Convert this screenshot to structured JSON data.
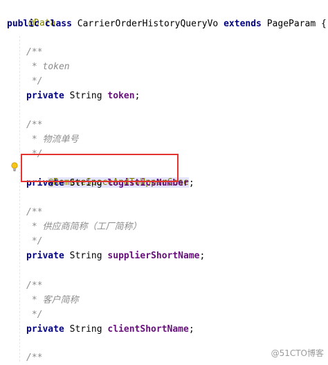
{
  "code": {
    "annotation_data": "@Data",
    "class_decl": {
      "kw_public": "public",
      "kw_class": "class",
      "class_name": "CarrierOrderHistoryQueryVo",
      "kw_extends": "extends",
      "super_name": "PageParam",
      "brace": "{"
    },
    "blocks": [
      {
        "doc_open": "/**",
        "doc_text": " * token",
        "doc_close": " */",
        "kw_private": "private",
        "type": "String",
        "field": "token",
        "semi": ";"
      },
      {
        "doc_open": "/**",
        "doc_text": " * 物流单号",
        "doc_close": " */",
        "annotation": "@RemoveSpaceAndToUpperCase",
        "kw_private": "private",
        "type": "String",
        "field": "logisticsNumber",
        "semi": ";"
      },
      {
        "doc_open": "/**",
        "doc_text": " * 供应商简称（工厂简称）",
        "doc_close": " */",
        "kw_private": "private",
        "type": "String",
        "field": "supplierShortName",
        "semi": ";"
      },
      {
        "doc_open": "/**",
        "doc_text": " * 客户简称",
        "doc_close": " */",
        "kw_private": "private",
        "type": "String",
        "field": "clientShortName",
        "semi": ";"
      },
      {
        "doc_open": "/**"
      }
    ]
  },
  "gutter": {
    "intention_icon": "lightbulb-icon"
  },
  "watermark": "@51CTO博客",
  "colors": {
    "keyword": "#000080",
    "annotation": "#808000",
    "doc_comment": "#8c8c8c",
    "field": "#660e7a",
    "highlight_box": "#e3342f"
  }
}
